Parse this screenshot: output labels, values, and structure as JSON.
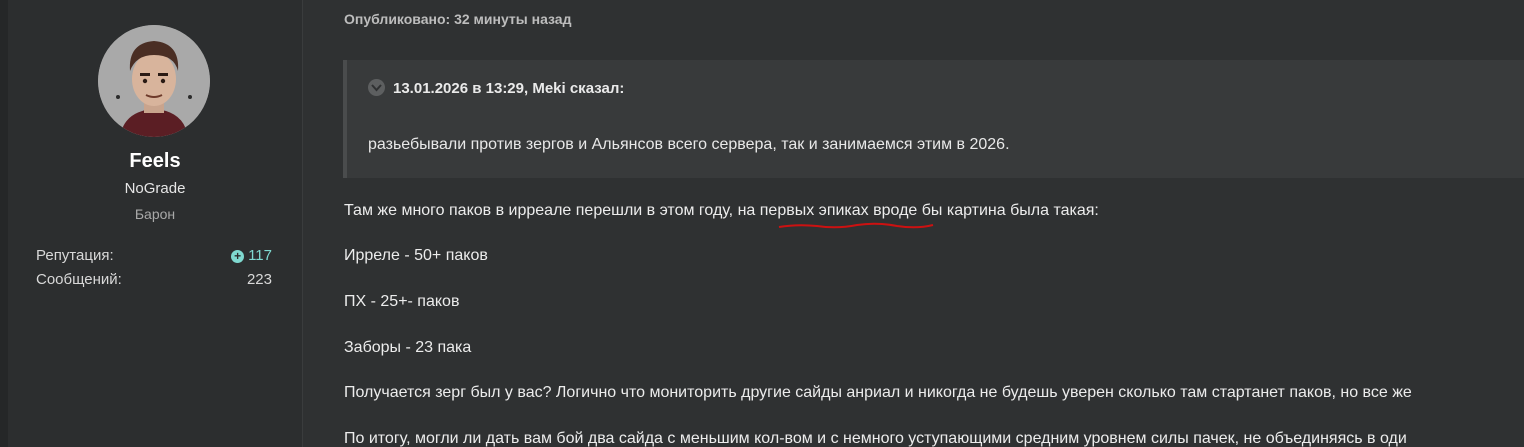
{
  "author": {
    "name": "Feels",
    "title": "NoGrade",
    "rank": "Барон",
    "stats": [
      {
        "label": "Репутация:",
        "value": "117"
      },
      {
        "label": "Сообщений:",
        "value": "223"
      }
    ]
  },
  "post": {
    "meta": "Опубликовано: 32 минуты назад",
    "quote": {
      "header": "13.01.2026 в 13:29, Meki сказал:",
      "text": "разьебывали против зергов и Альянсов всего сервера, так и занимаемся этим в 2026."
    },
    "paragraphs": [
      "Там же много паков в ирреале перешли в этом году, на первых эпиках вроде бы картина была такая:",
      "Ирреле - 50+ паков",
      "ПХ - 25+- паков",
      "Заборы - 23 пака",
      "Получается зерг был у вас? Логично что мониторить другие сайды анриал и никогда не будешь уверен сколько там стартанет паков, но все же",
      "По итогу, могли ли дать вам бой два сайда с меньшим кол-вом и с немного уступающими средним уровнем силы пачек, не объединяясь в оди"
    ]
  },
  "colors": {
    "background": "#2f3132",
    "sidebar": "#2c2e2f",
    "quote_bg": "#383a3b",
    "reputation": "#7fd9d0",
    "annotation_red": "#cc1111"
  }
}
